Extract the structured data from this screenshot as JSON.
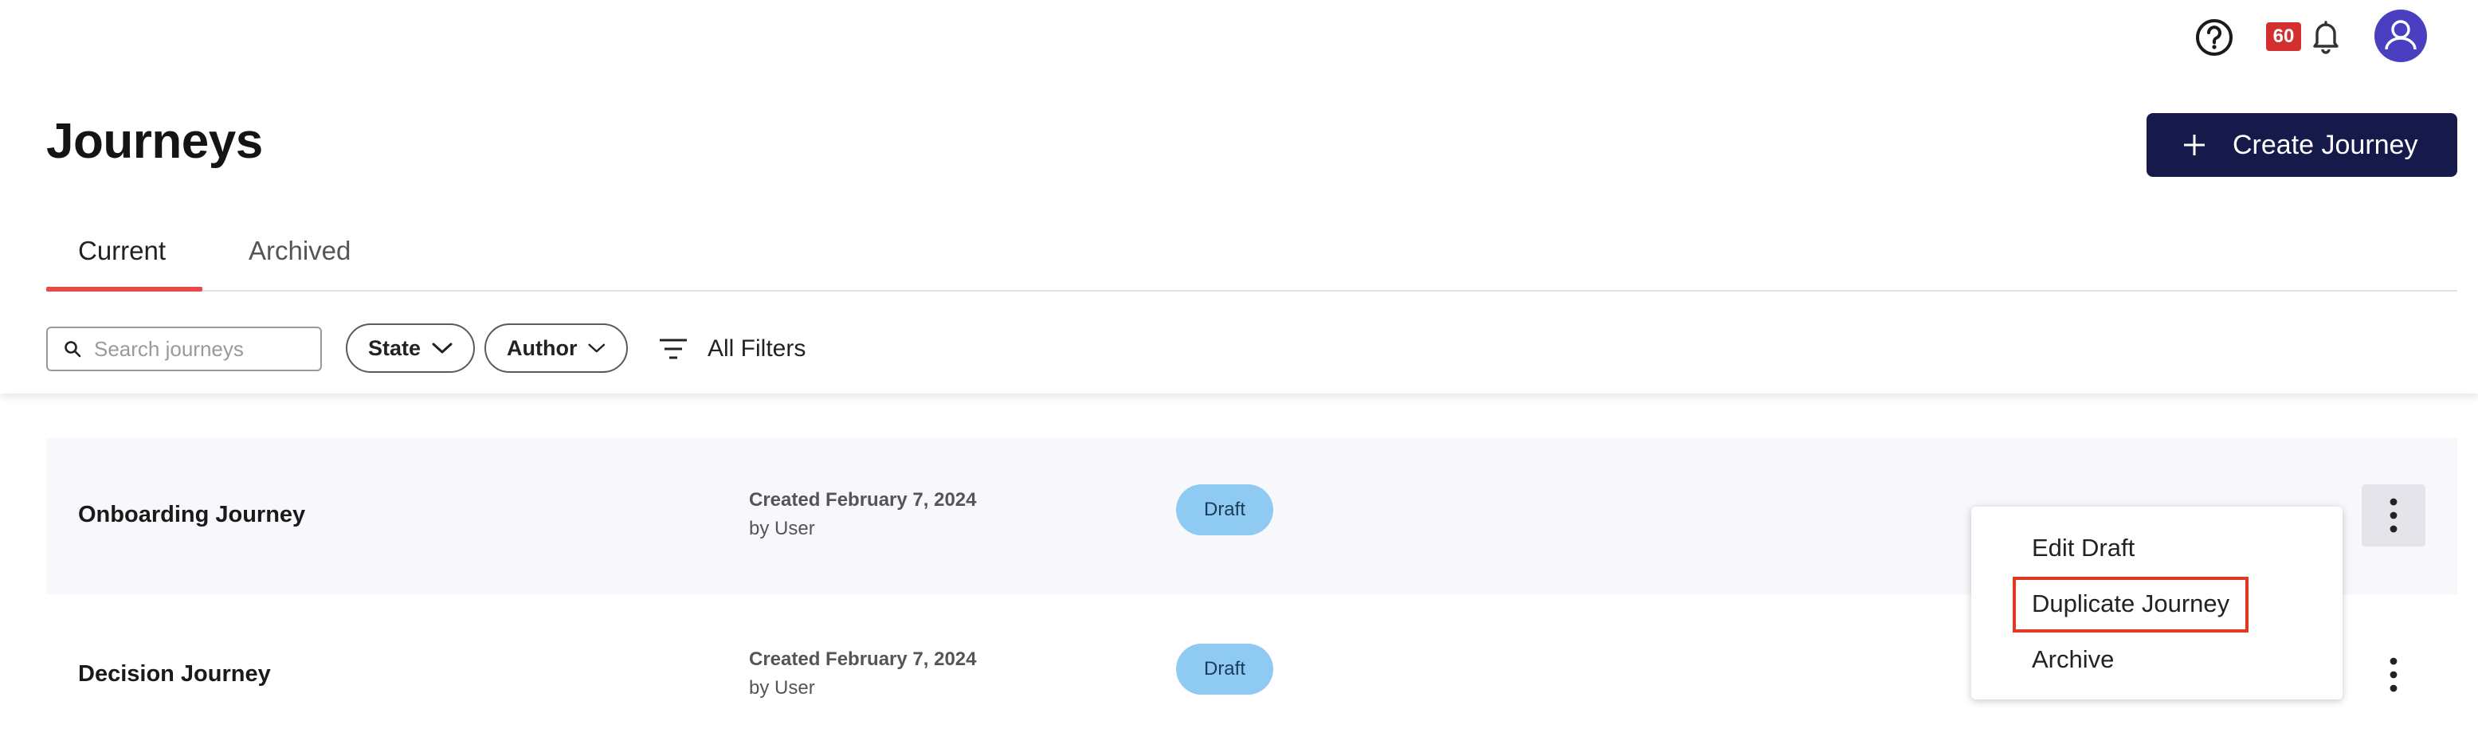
{
  "header": {
    "title": "Journeys",
    "create_label": "Create Journey",
    "notification_count": "60"
  },
  "icons": {
    "help": "help-circle-icon",
    "bell": "bell-icon",
    "avatar": "user-avatar-icon",
    "plus": "plus-icon",
    "search": "search-icon",
    "filter": "filter-icon",
    "chevron": "chevron-down-icon",
    "kebab": "kebab-menu-icon"
  },
  "colors": {
    "primary_button": "#161a4a",
    "tab_accent": "#e84a4a",
    "badge_red": "#d32f2f",
    "avatar": "#4a3fc1",
    "draft_badge": "#8fcaf3",
    "highlight": "#e0391f"
  },
  "tabs": [
    {
      "label": "Current",
      "active": true
    },
    {
      "label": "Archived",
      "active": false
    }
  ],
  "filters": {
    "search_placeholder": "Search journeys",
    "state_label": "State",
    "author_label": "Author",
    "all_filters_label": "All Filters"
  },
  "journeys": [
    {
      "name": "Onboarding Journey",
      "created": "Created February 7, 2024",
      "by": "by User",
      "status": "Draft"
    },
    {
      "name": "Decision Journey",
      "created": "Created February 7, 2024",
      "by": "by User",
      "status": "Draft"
    }
  ],
  "menu": {
    "items": [
      "Edit Draft",
      "Duplicate Journey",
      "Archive"
    ]
  }
}
